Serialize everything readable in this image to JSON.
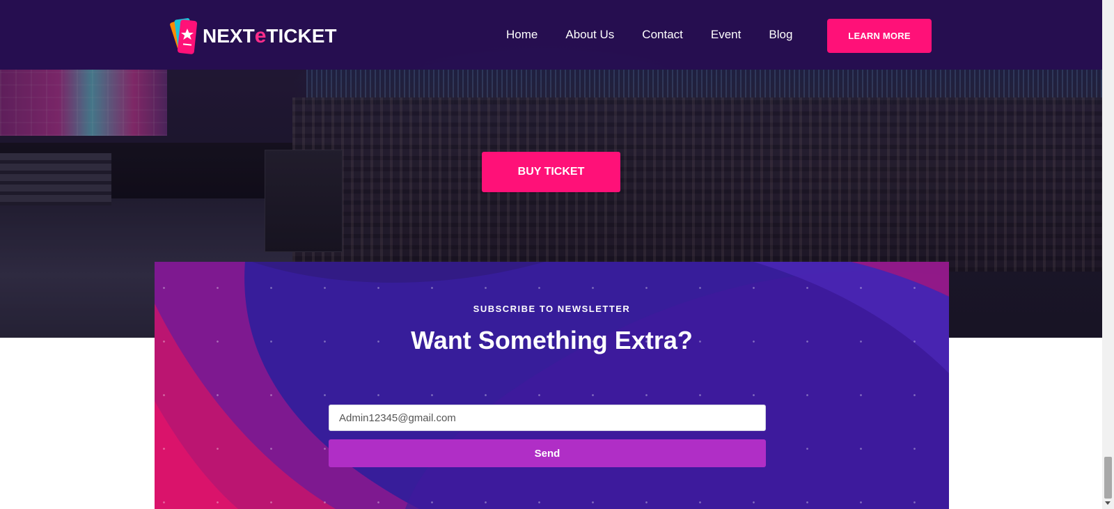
{
  "header": {
    "logo_text_prefix": "NEXT",
    "logo_text_e": "e",
    "logo_text_suffix": "TICKET",
    "nav": [
      {
        "label": "Home"
      },
      {
        "label": "About Us"
      },
      {
        "label": "Contact"
      },
      {
        "label": "Event"
      },
      {
        "label": "Blog"
      }
    ],
    "cta_label": "LEARN MORE"
  },
  "hero": {
    "buy_label": "BUY TICKET"
  },
  "newsletter": {
    "kicker": "SUBSCRIBE TO NEWSLETTER",
    "title": "Want Something Extra?",
    "email_value": "Admin12345@gmail.com",
    "send_label": "Send"
  },
  "colors": {
    "header_bg": "#260e52",
    "accent_pink": "#ff1178",
    "newsletter_bg": "#3d1a9c",
    "send_button": "#b02ec6"
  }
}
